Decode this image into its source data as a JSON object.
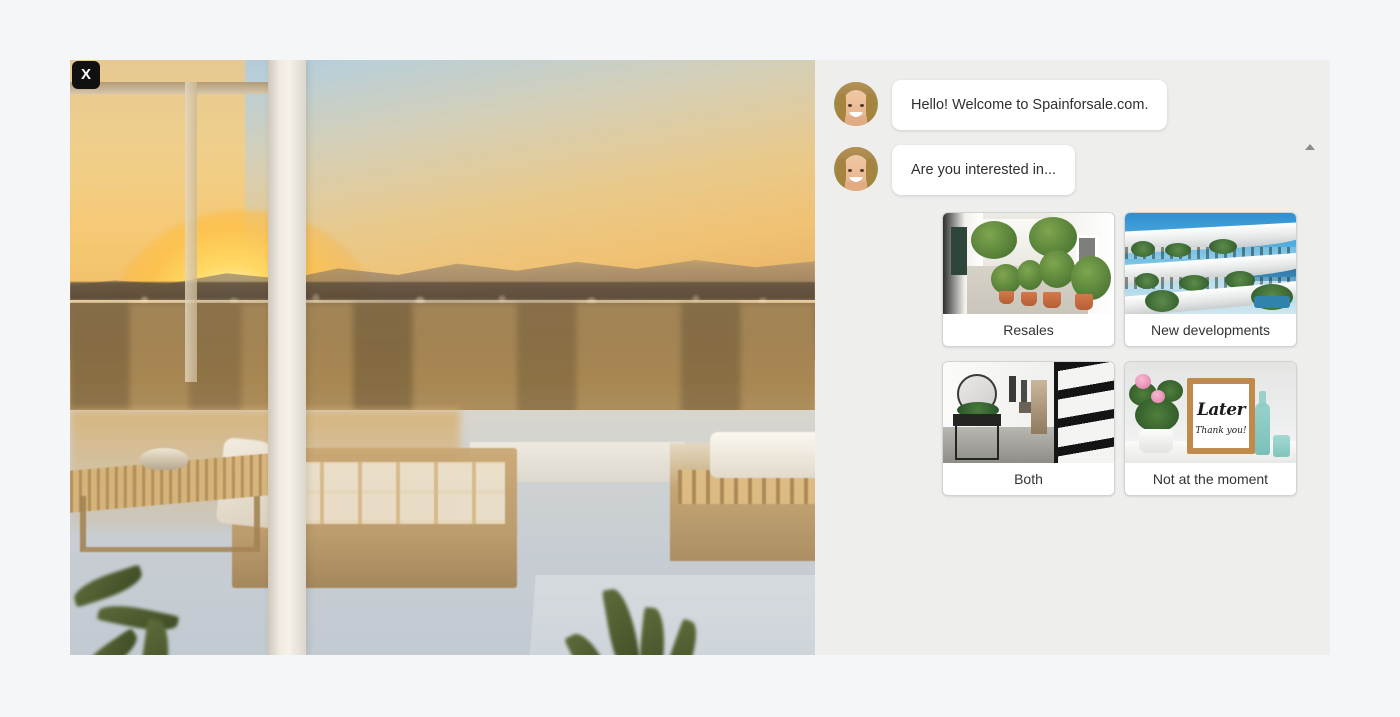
{
  "window": {
    "page_background": "#f4f6f8"
  },
  "hero": {
    "name": "property-sunset-terrace-video",
    "alt": "Rooftop terrace at sunset with rattan furniture and mountain view",
    "close_label": "X"
  },
  "chat": {
    "background": "#eeeeec",
    "scroll_up_label": "▲",
    "messages": [
      {
        "avatar_name": "agent-avatar",
        "text": "Hello! Welcome to Spainforsale.com."
      },
      {
        "avatar_name": "agent-avatar",
        "text": "Are you interested in..."
      }
    ],
    "options": [
      {
        "id": "resales",
        "label": "Resales",
        "thumb_name": "spanish-village-street-thumb"
      },
      {
        "id": "new-developments",
        "label": "New developments",
        "thumb_name": "modern-apartment-building-thumb"
      },
      {
        "id": "both",
        "label": "Both",
        "thumb_name": "minimal-hallway-thumb"
      },
      {
        "id": "not-at-the-moment",
        "label": "Not at the moment",
        "thumb_name": "later-thank-you-print-thumb"
      }
    ],
    "later_print": {
      "line1": "Later",
      "line2": "Thank you!"
    }
  }
}
